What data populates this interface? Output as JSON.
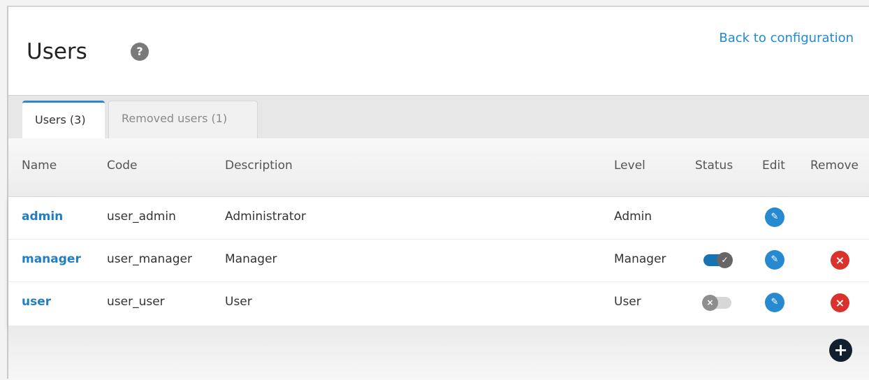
{
  "header": {
    "title": "Users",
    "help_icon": "question-circle-icon",
    "back_link": "Back to configuration"
  },
  "tabs": [
    {
      "label": "Users (3)",
      "active": true
    },
    {
      "label": "Removed users (1)",
      "active": false
    }
  ],
  "table": {
    "columns": [
      "Name",
      "Code",
      "Description",
      "Level",
      "Status",
      "Edit",
      "Remove"
    ],
    "rows": [
      {
        "name": "admin",
        "code": "user_admin",
        "description": "Administrator",
        "level": "Admin",
        "status": null,
        "edit_icon": "pencil-icon",
        "remove_icon": null
      },
      {
        "name": "manager",
        "code": "user_manager",
        "description": "Manager",
        "level": "Manager",
        "status": "enabled",
        "edit_icon": "pencil-icon",
        "remove_icon": "close-icon"
      },
      {
        "name": "user",
        "code": "user_user",
        "description": "User",
        "level": "User",
        "status": "disabled",
        "edit_icon": "pencil-icon",
        "remove_icon": "close-icon"
      }
    ]
  },
  "footer": {
    "add_icon": "plus-icon"
  },
  "colors": {
    "link": "#1f7fc1",
    "edit": "#2789cf",
    "remove": "#d9312b",
    "toggle_on": "#1774b3"
  }
}
